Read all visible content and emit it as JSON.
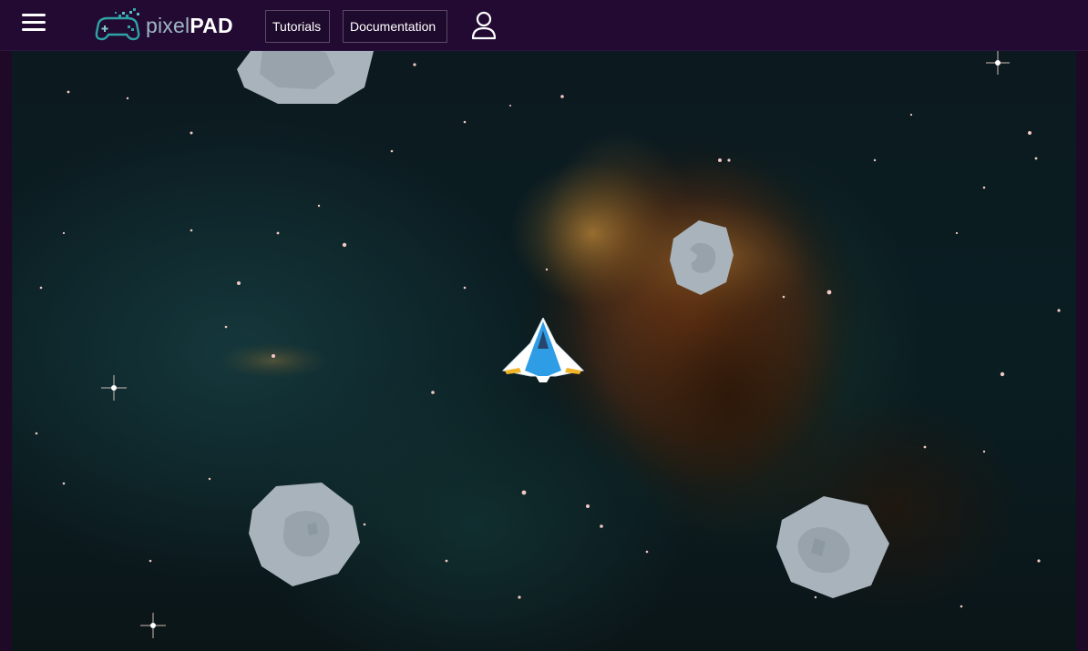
{
  "header": {
    "menu_icon": "hamburger-menu-icon",
    "logo": {
      "text_light": "pixel",
      "text_bold": "PAD",
      "icon": "gamepad-pixel-icon"
    },
    "nav": {
      "tutorials_label": "Tutorials",
      "documentation_label": "Documentation"
    },
    "user_icon": "user-account-icon"
  },
  "game": {
    "background": "space-nebula",
    "sprites": {
      "player": "spaceship",
      "asteroids": [
        "asteroid",
        "asteroid",
        "asteroid",
        "asteroid"
      ]
    }
  },
  "colors": {
    "header_bg": "#220a32",
    "ship_body": "#ffffff",
    "ship_accent": "#2f9de6",
    "asteroid": "#a9b3bb"
  }
}
